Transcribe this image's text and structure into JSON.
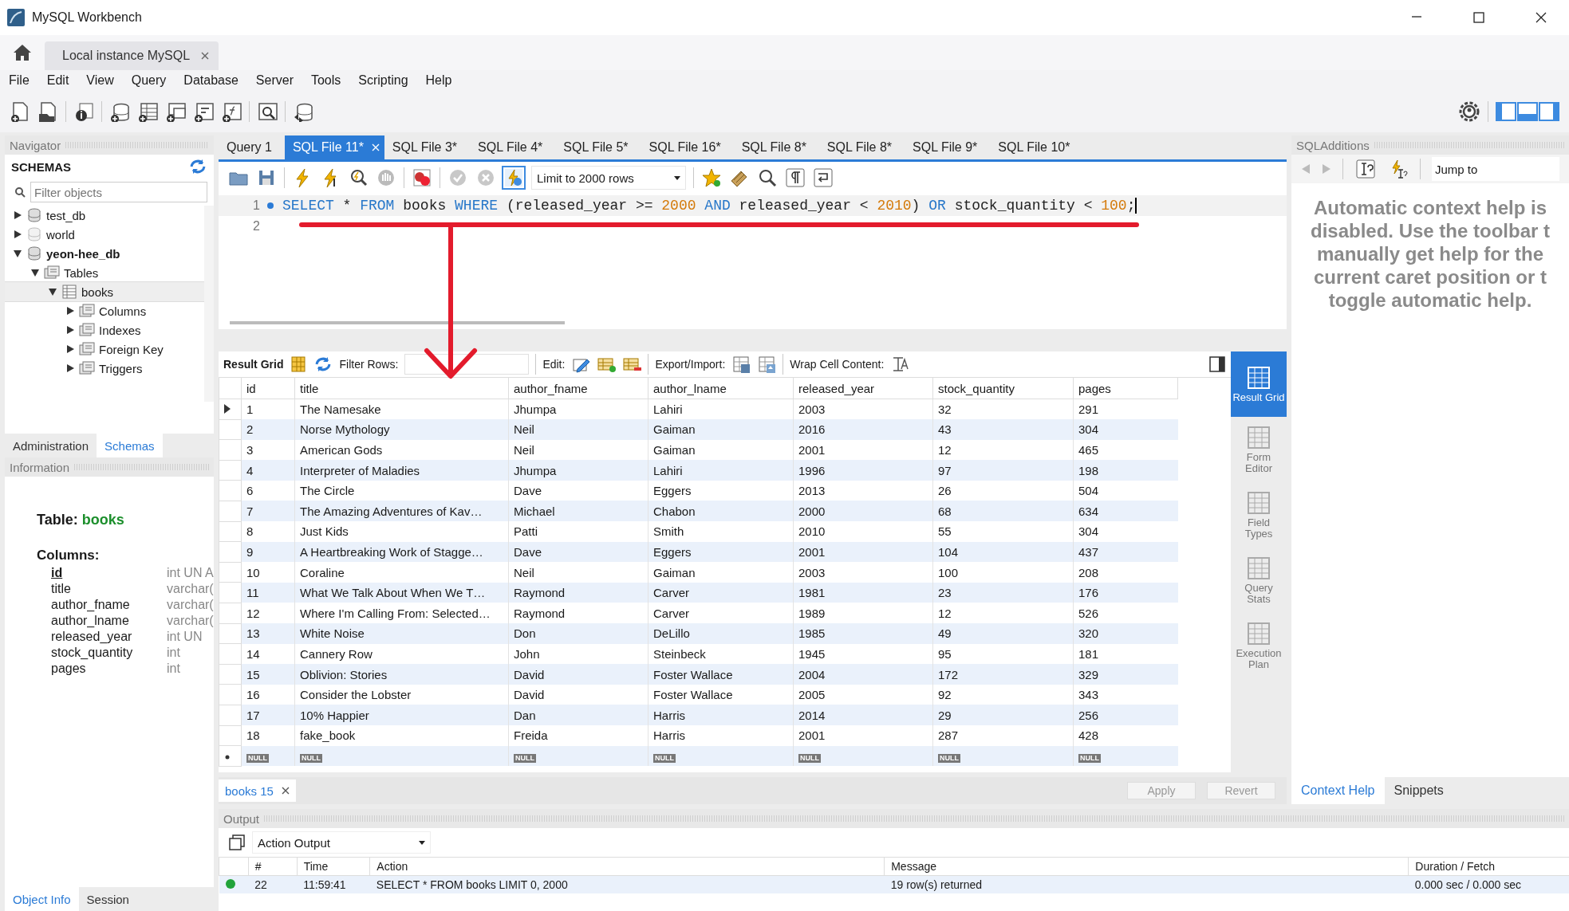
{
  "window": {
    "title": "MySQL Workbench"
  },
  "connection_tabs": [
    {
      "label": "Local instance MySQL",
      "selected": true
    }
  ],
  "menu": [
    "File",
    "Edit",
    "View",
    "Query",
    "Database",
    "Server",
    "Tools",
    "Scripting",
    "Help"
  ],
  "navigator": {
    "title": "Navigator",
    "schemas_label": "SCHEMAS",
    "filter": {
      "placeholder": "Filter objects"
    },
    "tree": [
      {
        "label": "test_db",
        "kind": "schema",
        "default": false,
        "expanded": false,
        "selected": false
      },
      {
        "label": "world",
        "kind": "schema-off",
        "default": false,
        "expanded": false,
        "selected": false
      },
      {
        "label": "yeon-hee_db",
        "kind": "schema",
        "default": true,
        "expanded": true,
        "selected": false,
        "children": [
          {
            "label": "Tables",
            "kind": "folder",
            "default": false,
            "expanded": true,
            "selected": false,
            "children": [
              {
                "label": "books",
                "kind": "table",
                "default": false,
                "expanded": true,
                "selected": true,
                "children": [
                  {
                    "label": "Columns",
                    "kind": "folder",
                    "default": false,
                    "expanded": false,
                    "selected": false
                  },
                  {
                    "label": "Indexes",
                    "kind": "folder",
                    "default": false,
                    "expanded": false,
                    "selected": false
                  },
                  {
                    "label": "Foreign Key",
                    "kind": "folder",
                    "default": false,
                    "expanded": false,
                    "selected": false
                  },
                  {
                    "label": "Triggers",
                    "kind": "folder",
                    "default": false,
                    "expanded": false,
                    "selected": false
                  }
                ]
              }
            ]
          }
        ]
      }
    ]
  },
  "panel_tabs": [
    {
      "label": "Administration",
      "selected": false
    },
    {
      "label": "Schemas",
      "selected": true
    }
  ],
  "information": {
    "title": "Information",
    "table_label": "Table:",
    "table_name": "books",
    "columns_label": "Columns:",
    "columns": [
      {
        "name": "id",
        "type": "int UN A",
        "primary": true
      },
      {
        "name": "title",
        "type": "varchar(",
        "primary": false
      },
      {
        "name": "author_fname",
        "type": "varchar(",
        "primary": false
      },
      {
        "name": "author_lname",
        "type": "varchar(",
        "primary": false
      },
      {
        "name": "released_year",
        "type": "int UN",
        "primary": false
      },
      {
        "name": "stock_quantity",
        "type": "int",
        "primary": false
      },
      {
        "name": "pages",
        "type": "int",
        "primary": false
      }
    ]
  },
  "info_tabs": [
    {
      "label": "Object Info",
      "selected": true
    },
    {
      "label": "Session",
      "selected": false
    }
  ],
  "query_tabs": [
    {
      "label": "Query 1",
      "selected": false
    },
    {
      "label": "SQL File 11*",
      "selected": true
    },
    {
      "label": "SQL File 3*",
      "selected": false
    },
    {
      "label": "SQL File 4*",
      "selected": false
    },
    {
      "label": "SQL File 5*",
      "selected": false
    },
    {
      "label": "SQL File 16*",
      "selected": false
    },
    {
      "label": "SQL File 8*",
      "selected": false
    },
    {
      "label": "SQL File 8*",
      "selected": false
    },
    {
      "label": "SQL File 9*",
      "selected": false
    },
    {
      "label": "SQL File 10*",
      "selected": false
    }
  ],
  "limit": "Limit to 2000 rows",
  "editor": {
    "lines": [
      {
        "number": "1",
        "marker": true,
        "tokens": [
          {
            "text": "SELECT",
            "kind": "keyword"
          },
          {
            "text": " * ",
            "kind": "plain"
          },
          {
            "text": "FROM",
            "kind": "keyword"
          },
          {
            "text": " books ",
            "kind": "plain"
          },
          {
            "text": "WHERE",
            "kind": "keyword"
          },
          {
            "text": " (released_year >= ",
            "kind": "plain"
          },
          {
            "text": "2000",
            "kind": "number"
          },
          {
            "text": " AND",
            "kind": "keyword"
          },
          {
            "text": " released_year < ",
            "kind": "plain"
          },
          {
            "text": "2010",
            "kind": "number"
          },
          {
            "text": ") ",
            "kind": "plain"
          },
          {
            "text": "OR",
            "kind": "keyword"
          },
          {
            "text": " stock_quantity < ",
            "kind": "plain"
          },
          {
            "text": "100",
            "kind": "number"
          },
          {
            "text": ";",
            "kind": "plain"
          }
        ]
      },
      {
        "number": "2",
        "marker": false
      }
    ]
  },
  "result": {
    "grid_label": "Result Grid",
    "filter_label": "Filter Rows:",
    "edit_label": "Edit:",
    "export_label": "Export/Import:",
    "wrap_label": "Wrap Cell Content:",
    "columns": [
      "id",
      "title",
      "author_fname",
      "author_lname",
      "released_year",
      "stock_quantity",
      "pages"
    ],
    "rows": [
      {
        "selected": true,
        "cells": [
          "1",
          "The Namesake",
          "Jhumpa",
          "Lahiri",
          "2003",
          "32",
          "291"
        ]
      },
      {
        "selected": false,
        "cells": [
          "2",
          "Norse Mythology",
          "Neil",
          "Gaiman",
          "2016",
          "43",
          "304"
        ]
      },
      {
        "selected": false,
        "cells": [
          "3",
          "American Gods",
          "Neil",
          "Gaiman",
          "2001",
          "12",
          "465"
        ]
      },
      {
        "selected": false,
        "cells": [
          "4",
          "Interpreter of Maladies",
          "Jhumpa",
          "Lahiri",
          "1996",
          "97",
          "198"
        ]
      },
      {
        "selected": false,
        "cells": [
          "6",
          "The Circle",
          "Dave",
          "Eggers",
          "2013",
          "26",
          "504"
        ]
      },
      {
        "selected": false,
        "cells": [
          "7",
          "The Amazing Adventures of Kav…",
          "Michael",
          "Chabon",
          "2000",
          "68",
          "634"
        ]
      },
      {
        "selected": false,
        "cells": [
          "8",
          "Just Kids",
          "Patti",
          "Smith",
          "2010",
          "55",
          "304"
        ]
      },
      {
        "selected": false,
        "cells": [
          "9",
          "A Heartbreaking Work of Stagge…",
          "Dave",
          "Eggers",
          "2001",
          "104",
          "437"
        ]
      },
      {
        "selected": false,
        "cells": [
          "10",
          "Coraline",
          "Neil",
          "Gaiman",
          "2003",
          "100",
          "208"
        ]
      },
      {
        "selected": false,
        "cells": [
          "11",
          "What We Talk About When We T…",
          "Raymond",
          "Carver",
          "1981",
          "23",
          "176"
        ]
      },
      {
        "selected": false,
        "cells": [
          "12",
          "Where I'm Calling From: Selected…",
          "Raymond",
          "Carver",
          "1989",
          "12",
          "526"
        ]
      },
      {
        "selected": false,
        "cells": [
          "13",
          "White Noise",
          "Don",
          "DeLillo",
          "1985",
          "49",
          "320"
        ]
      },
      {
        "selected": false,
        "cells": [
          "14",
          "Cannery Row",
          "John",
          "Steinbeck",
          "1945",
          "95",
          "181"
        ]
      },
      {
        "selected": false,
        "cells": [
          "15",
          "Oblivion: Stories",
          "David",
          "Foster Wallace",
          "2004",
          "172",
          "329"
        ]
      },
      {
        "selected": false,
        "cells": [
          "16",
          "Consider the Lobster",
          "David",
          "Foster Wallace",
          "2005",
          "92",
          "343"
        ]
      },
      {
        "selected": false,
        "cells": [
          "17",
          "10% Happier",
          "Dan",
          "Harris",
          "2014",
          "29",
          "256"
        ]
      },
      {
        "selected": false,
        "cells": [
          "18",
          "fake_book",
          "Freida",
          "Harris",
          "2001",
          "287",
          "428"
        ]
      }
    ],
    "new_row": [
      "NULL",
      "NULL",
      "NULL",
      "NULL",
      "NULL",
      "NULL",
      "NULL"
    ]
  },
  "views": [
    {
      "label": "Result Grid",
      "selected": true
    },
    {
      "label": "Form Editor",
      "selected": false
    },
    {
      "label": "Field Types",
      "selected": false
    },
    {
      "label": "Query Stats",
      "selected": false
    },
    {
      "label": "Execution Plan",
      "selected": false
    }
  ],
  "result_tabs": [
    {
      "label": "books 15",
      "selected": true
    }
  ],
  "actions": [
    {
      "label": "Apply",
      "disabled": true
    },
    {
      "label": "Revert",
      "disabled": true
    }
  ],
  "sql_additions": {
    "title": "SQLAdditions",
    "jump_to": "Jump to",
    "help_lines": [
      "Automatic context help is",
      "disabled. Use the toolbar t",
      "manually get help for the",
      "current caret position or t",
      "toggle automatic help."
    ],
    "tabs": [
      {
        "label": "Context Help",
        "selected": true
      },
      {
        "label": "Snippets",
        "selected": false
      }
    ]
  },
  "output": {
    "title": "Output",
    "mode": "Action Output",
    "columns": [
      "#",
      "Time",
      "Action",
      "Message",
      "Duration / Fetch"
    ],
    "rows": [
      {
        "succeeded": true,
        "cells": [
          "22",
          "11:59:41",
          "SELECT * FROM books LIMIT 0, 2000",
          "19 row(s) returned",
          "0.000 sec / 0.000 sec"
        ]
      }
    ]
  }
}
